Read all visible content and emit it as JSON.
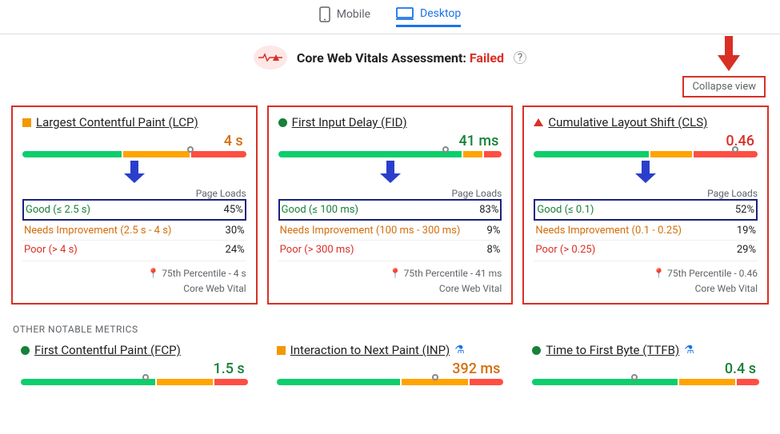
{
  "tabs": {
    "mobile": "Mobile",
    "desktop": "Desktop"
  },
  "assessment": {
    "label": "Core Web Vitals Assessment:",
    "status": "Failed"
  },
  "collapse_label": "Collapse view",
  "pageloads_label": "Page Loads",
  "colors": {
    "good": "#0cce6b",
    "ni": "#ffa400",
    "poor": "#ff4e42",
    "accent": "#1a73e8",
    "fail": "#d93025"
  },
  "core_metrics": [
    {
      "shape": "square",
      "name": "Largest Contentful Paint (LCP)",
      "value": "4 s",
      "value_color": "orange",
      "bar": {
        "g": 45,
        "o": 30,
        "r": 25,
        "tick": 75
      },
      "good": {
        "label": "Good (≤ 2.5 s)",
        "pct": "45%"
      },
      "ni": {
        "label": "Needs Improvement (2.5 s - 4 s)",
        "pct": "30%"
      },
      "poor": {
        "label": "Poor (> 4 s)",
        "pct": "24%"
      },
      "percentile": "75th Percentile - 4 s",
      "cwv": "Core Web Vital"
    },
    {
      "shape": "circle",
      "name": "First Input Delay (FID)",
      "value": "41 ms",
      "value_color": "green",
      "bar": {
        "g": 83,
        "o": 9,
        "r": 8,
        "tick": 75
      },
      "good": {
        "label": "Good (≤ 100 ms)",
        "pct": "83%"
      },
      "ni": {
        "label": "Needs Improvement (100 ms - 300 ms)",
        "pct": "9%"
      },
      "poor": {
        "label": "Poor (> 300 ms)",
        "pct": "8%"
      },
      "percentile": "75th Percentile - 41 ms",
      "cwv": "Core Web Vital"
    },
    {
      "shape": "triangle",
      "name": "Cumulative Layout Shift (CLS)",
      "value": "0.46",
      "value_color": "red",
      "bar": {
        "g": 52,
        "o": 19,
        "r": 29,
        "tick": 90
      },
      "good": {
        "label": "Good (≤ 0.1)",
        "pct": "52%"
      },
      "ni": {
        "label": "Needs Improvement (0.1 - 0.25)",
        "pct": "19%"
      },
      "poor": {
        "label": "Poor (> 0.25)",
        "pct": "29%"
      },
      "percentile": "75th Percentile - 0.46",
      "cwv": "Core Web Vital"
    }
  ],
  "other_hdr": "OTHER NOTABLE METRICS",
  "other_metrics": [
    {
      "shape": "circle",
      "name": "First Contentful Paint (FCP)",
      "value": "1.5 s",
      "value_color": "green",
      "bar": {
        "g": 60,
        "o": 25,
        "r": 15,
        "tick": 55
      },
      "flask": false
    },
    {
      "shape": "square",
      "name": "Interaction to Next Paint (INP)",
      "value": "392 ms",
      "value_color": "orange",
      "bar": {
        "g": 55,
        "o": 30,
        "r": 15,
        "tick": 70
      },
      "flask": true
    },
    {
      "shape": "circle",
      "name": "Time to First Byte (TTFB)",
      "value": "0.4 s",
      "value_color": "green",
      "bar": {
        "g": 65,
        "o": 25,
        "r": 10,
        "tick": 45
      },
      "flask": true
    }
  ]
}
